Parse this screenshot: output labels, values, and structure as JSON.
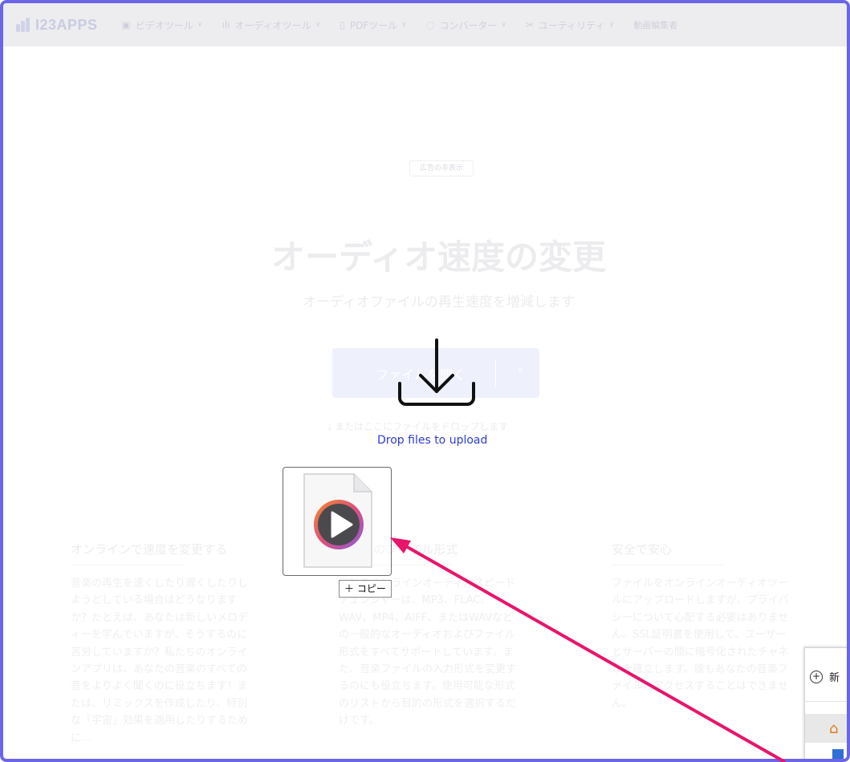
{
  "nav": {
    "logo": "I23APPS",
    "items": [
      {
        "label": "ビデオツール",
        "icon": "video-icon"
      },
      {
        "label": "オーディオツール",
        "icon": "audio-wave-icon"
      },
      {
        "label": "PDFツール",
        "icon": "pdf-icon"
      },
      {
        "label": "コンバーター",
        "icon": "converter-icon"
      },
      {
        "label": "ユーティリティ",
        "icon": "scissors-icon"
      }
    ],
    "trailing": "動画編集者"
  },
  "ad_label": "広告の非表示",
  "hero": {
    "title": "オーディオ速度の変更",
    "subtitle": "オーディオファイルの再生速度を増減します"
  },
  "upload": {
    "button_label": "ファイルを開く",
    "drop_hint": "またはここにファイルをドロップします",
    "drop_overlay_text": "Drop files to upload"
  },
  "columns": [
    {
      "heading": "オンラインで速度を変更する",
      "body": "音楽の再生を速くしたり遅くしたりしようとしている場合はどうなりますか？たとえば、あなたは新しいメロディーを学んでいますが、そうするのに苦労していますか？私たちのオンラインアプリは、あなたの音楽のすべての音をよりよく聞くのに役立ちます！または、リミックスを作成したり、特別な「宇宙」効果を適用したりするために…"
    },
    {
      "heading": "すべてのファイル形式",
      "body": "当社のオンラインオーディオスピードチェンジャーは、MP3、FLAC、WAV、MP4、AIFF、またはWAVなどの一般的なオーディオおよびファイル形式をすべてサポートしています。また、音楽ファイルの入力形式を変更するのにも役立ちます。使用可能な形式のリストから目的の形式を選択するだけです。"
    },
    {
      "heading": "安全で安心",
      "body": "ファイルをオンラインオーディオツールにアップロードしますが、プライバシーについて心配する必要はありません。SSL証明書を使用して、ユーザーとサーバーの間に暗号化されたチャネルを確立します。誰もあなたの音楽ファイルにアクセスすることはできません。"
    }
  ],
  "drag": {
    "copy_label": "＋ コピー",
    "file_icon": "media-file-icon"
  },
  "context_menu": {
    "new_label": "新"
  },
  "colors": {
    "frame": "#6b66e8",
    "arrow": "#e8156b",
    "drop_text": "#2e3ed0"
  }
}
